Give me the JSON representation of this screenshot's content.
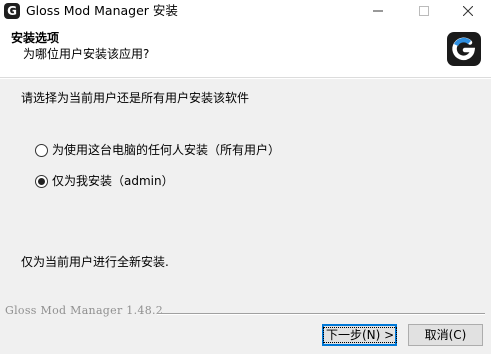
{
  "window": {
    "title": "Gloss Mod Manager 安装",
    "app_icon": "gloss-g-icon",
    "controls": [
      "minimize-icon",
      "maximize-icon",
      "close-icon"
    ]
  },
  "header": {
    "title": "安装选项",
    "subtitle": "为哪位用户安装该应用?",
    "logo": "gloss-g-logo"
  },
  "content": {
    "prompt": "请选择为当前用户还是所有用户安装该软件",
    "options": [
      {
        "label": "为使用这台电脑的任何人安装（所有用户）",
        "checked": false
      },
      {
        "label": "仅为我安装（admin）",
        "checked": true
      }
    ],
    "description": "仅为当前用户进行全新安装."
  },
  "footer": {
    "version": "Gloss Mod Manager 1.48.2",
    "next_label": "下一步(N) >",
    "cancel_label": "取消(C)"
  },
  "colors": {
    "dialog_bg": "#f0f0f0",
    "header_bg": "#ffffff",
    "focus_border": "#0078d7",
    "logo_bg": "#1a1a1a"
  }
}
